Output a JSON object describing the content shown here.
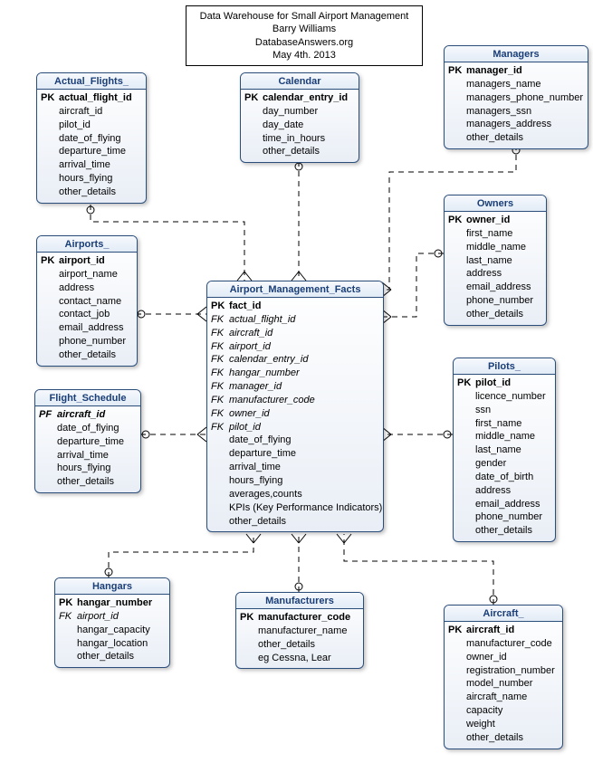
{
  "title": {
    "line1": "Data Warehouse for Small Airport Management",
    "line2": "Barry Williams",
    "line3": "DatabaseAnswers.org",
    "line4": "May 4th. 2013"
  },
  "entities": {
    "actual_flights": {
      "name": "Actual_Flights_",
      "fields": [
        {
          "key": "PK",
          "name": "actual_flight_id",
          "kind": "pk"
        },
        {
          "key": "",
          "name": "aircraft_id",
          "kind": ""
        },
        {
          "key": "",
          "name": "pilot_id",
          "kind": ""
        },
        {
          "key": "",
          "name": "date_of_flying",
          "kind": ""
        },
        {
          "key": "",
          "name": "departure_time",
          "kind": ""
        },
        {
          "key": "",
          "name": "arrival_time",
          "kind": ""
        },
        {
          "key": "",
          "name": "hours_flying",
          "kind": ""
        },
        {
          "key": "",
          "name": "other_details",
          "kind": ""
        }
      ]
    },
    "calendar": {
      "name": "Calendar",
      "fields": [
        {
          "key": "PK",
          "name": "calendar_entry_id",
          "kind": "pk"
        },
        {
          "key": "",
          "name": "day_number",
          "kind": ""
        },
        {
          "key": "",
          "name": "day_date",
          "kind": ""
        },
        {
          "key": "",
          "name": "time_in_hours",
          "kind": ""
        },
        {
          "key": "",
          "name": "other_details",
          "kind": ""
        }
      ]
    },
    "managers": {
      "name": "Managers",
      "fields": [
        {
          "key": "PK",
          "name": "manager_id",
          "kind": "pk"
        },
        {
          "key": "",
          "name": "managers_name",
          "kind": ""
        },
        {
          "key": "",
          "name": "managers_phone_number",
          "kind": ""
        },
        {
          "key": "",
          "name": "managers_ssn",
          "kind": ""
        },
        {
          "key": "",
          "name": "managers_address",
          "kind": ""
        },
        {
          "key": "",
          "name": "other_details",
          "kind": ""
        }
      ]
    },
    "airports": {
      "name": "Airports_",
      "fields": [
        {
          "key": "PK",
          "name": "airport_id",
          "kind": "pk"
        },
        {
          "key": "",
          "name": "airport_name",
          "kind": ""
        },
        {
          "key": "",
          "name": "address",
          "kind": ""
        },
        {
          "key": "",
          "name": "contact_name",
          "kind": ""
        },
        {
          "key": "",
          "name": "contact_job",
          "kind": ""
        },
        {
          "key": "",
          "name": "email_address",
          "kind": ""
        },
        {
          "key": "",
          "name": "phone_number",
          "kind": ""
        },
        {
          "key": "",
          "name": "other_details",
          "kind": ""
        }
      ]
    },
    "owners": {
      "name": "Owners",
      "fields": [
        {
          "key": "PK",
          "name": "owner_id",
          "kind": "pk"
        },
        {
          "key": "",
          "name": "first_name",
          "kind": ""
        },
        {
          "key": "",
          "name": "middle_name",
          "kind": ""
        },
        {
          "key": "",
          "name": "last_name",
          "kind": ""
        },
        {
          "key": "",
          "name": "address",
          "kind": ""
        },
        {
          "key": "",
          "name": "email_address",
          "kind": ""
        },
        {
          "key": "",
          "name": "phone_number",
          "kind": ""
        },
        {
          "key": "",
          "name": "other_details",
          "kind": ""
        }
      ]
    },
    "facts": {
      "name": "Airport_Management_Facts",
      "fields": [
        {
          "key": "PK",
          "name": "fact_id",
          "kind": "pk"
        },
        {
          "key": "FK",
          "name": "actual_flight_id",
          "kind": "fk"
        },
        {
          "key": "FK",
          "name": "aircraft_id",
          "kind": "fk"
        },
        {
          "key": "FK",
          "name": "airport_id",
          "kind": "fk"
        },
        {
          "key": "FK",
          "name": "calendar_entry_id",
          "kind": "fk"
        },
        {
          "key": "FK",
          "name": "hangar_number",
          "kind": "fk"
        },
        {
          "key": "FK",
          "name": "manager_id",
          "kind": "fk"
        },
        {
          "key": "FK",
          "name": "manufacturer_code",
          "kind": "fk"
        },
        {
          "key": "FK",
          "name": "owner_id",
          "kind": "fk"
        },
        {
          "key": "FK",
          "name": "pilot_id",
          "kind": "fk"
        },
        {
          "key": "",
          "name": "date_of_flying",
          "kind": ""
        },
        {
          "key": "",
          "name": "departure_time",
          "kind": ""
        },
        {
          "key": "",
          "name": "arrival_time",
          "kind": ""
        },
        {
          "key": "",
          "name": "hours_flying",
          "kind": ""
        },
        {
          "key": "",
          "name": "averages,counts",
          "kind": ""
        },
        {
          "key": "",
          "name": "KPIs (Key Performance Indicators)",
          "kind": ""
        },
        {
          "key": "",
          "name": "other_details",
          "kind": ""
        }
      ]
    },
    "flight_schedule": {
      "name": "Flight_Schedule",
      "fields": [
        {
          "key": "PF",
          "name": "aircraft_id",
          "kind": "pf"
        },
        {
          "key": "",
          "name": "date_of_flying",
          "kind": ""
        },
        {
          "key": "",
          "name": "departure_time",
          "kind": ""
        },
        {
          "key": "",
          "name": "arrival_time",
          "kind": ""
        },
        {
          "key": "",
          "name": "hours_flying",
          "kind": ""
        },
        {
          "key": "",
          "name": "other_details",
          "kind": ""
        }
      ]
    },
    "pilots": {
      "name": "Pilots_",
      "fields": [
        {
          "key": "PK",
          "name": "pilot_id",
          "kind": "pk"
        },
        {
          "key": "",
          "name": "licence_number",
          "kind": ""
        },
        {
          "key": "",
          "name": "ssn",
          "kind": ""
        },
        {
          "key": "",
          "name": "first_name",
          "kind": ""
        },
        {
          "key": "",
          "name": "middle_name",
          "kind": ""
        },
        {
          "key": "",
          "name": "last_name",
          "kind": ""
        },
        {
          "key": "",
          "name": "gender",
          "kind": ""
        },
        {
          "key": "",
          "name": "date_of_birth",
          "kind": ""
        },
        {
          "key": "",
          "name": "address",
          "kind": ""
        },
        {
          "key": "",
          "name": "email_address",
          "kind": ""
        },
        {
          "key": "",
          "name": "phone_number",
          "kind": ""
        },
        {
          "key": "",
          "name": "other_details",
          "kind": ""
        }
      ]
    },
    "hangars": {
      "name": "Hangars",
      "fields": [
        {
          "key": "PK",
          "name": "hangar_number",
          "kind": "pk"
        },
        {
          "key": "FK",
          "name": "airport_id",
          "kind": "fk"
        },
        {
          "key": "",
          "name": "hangar_capacity",
          "kind": ""
        },
        {
          "key": "",
          "name": "hangar_location",
          "kind": ""
        },
        {
          "key": "",
          "name": "other_details",
          "kind": ""
        }
      ]
    },
    "manufacturers": {
      "name": "Manufacturers",
      "fields": [
        {
          "key": "PK",
          "name": "manufacturer_code",
          "kind": "pk"
        },
        {
          "key": "",
          "name": "manufacturer_name",
          "kind": ""
        },
        {
          "key": "",
          "name": "other_details",
          "kind": ""
        },
        {
          "key": "",
          "name": "eg Cessna, Lear",
          "kind": ""
        }
      ]
    },
    "aircraft": {
      "name": "Aircraft_",
      "fields": [
        {
          "key": "PK",
          "name": "aircraft_id",
          "kind": "pk"
        },
        {
          "key": "",
          "name": "manufacturer_code",
          "kind": ""
        },
        {
          "key": "",
          "name": "owner_id",
          "kind": ""
        },
        {
          "key": "",
          "name": "registration_number",
          "kind": ""
        },
        {
          "key": "",
          "name": "model_number",
          "kind": ""
        },
        {
          "key": "",
          "name": "aircraft_name",
          "kind": ""
        },
        {
          "key": "",
          "name": "capacity",
          "kind": ""
        },
        {
          "key": "",
          "name": "weight",
          "kind": ""
        },
        {
          "key": "",
          "name": "other_details",
          "kind": ""
        }
      ]
    }
  }
}
